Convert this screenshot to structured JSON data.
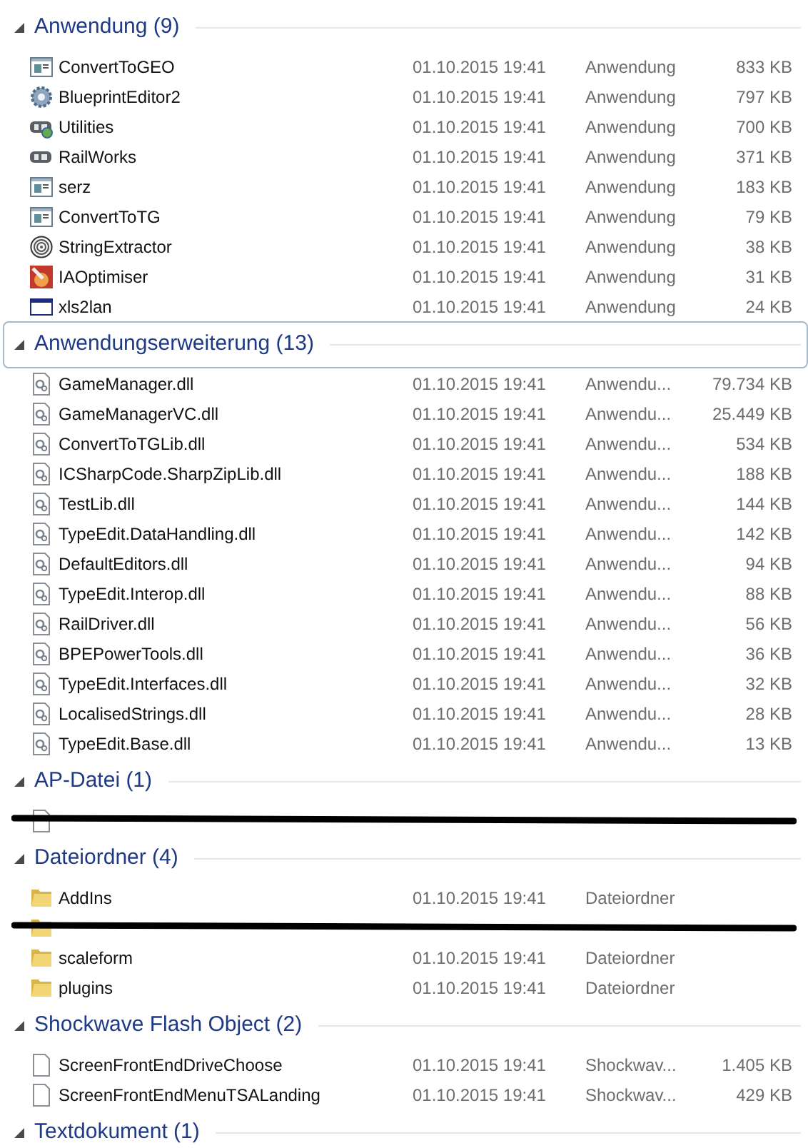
{
  "groups": [
    {
      "title": "Anwendung (9)",
      "expanded": true,
      "focused": false,
      "items": [
        {
          "kind": "app",
          "name": "ConvertToGEO",
          "date": "01.10.2015 19:41",
          "type": "Anwendung",
          "size": "833 KB"
        },
        {
          "kind": "gear",
          "name": "BlueprintEditor2",
          "date": "01.10.2015 19:41",
          "type": "Anwendung",
          "size": "797 KB"
        },
        {
          "kind": "badgeglobe",
          "name": "Utilities",
          "date": "01.10.2015 19:41",
          "type": "Anwendung",
          "size": "700 KB"
        },
        {
          "kind": "badge",
          "name": "RailWorks",
          "date": "01.10.2015 19:41",
          "type": "Anwendung",
          "size": "371 KB"
        },
        {
          "kind": "app",
          "name": "serz",
          "date": "01.10.2015 19:41",
          "type": "Anwendung",
          "size": "183 KB"
        },
        {
          "kind": "app",
          "name": "ConvertToTG",
          "date": "01.10.2015 19:41",
          "type": "Anwendung",
          "size": "79 KB"
        },
        {
          "kind": "fingerprint",
          "name": "StringExtractor",
          "date": "01.10.2015 19:41",
          "type": "Anwendung",
          "size": "38 KB"
        },
        {
          "kind": "tool",
          "name": "IAOptimiser",
          "date": "01.10.2015 19:41",
          "type": "Anwendung",
          "size": "31 KB"
        },
        {
          "kind": "window",
          "name": "xls2lan",
          "date": "01.10.2015 19:41",
          "type": "Anwendung",
          "size": "24 KB"
        }
      ]
    },
    {
      "title": "Anwendungserweiterung (13)",
      "expanded": true,
      "focused": true,
      "items": [
        {
          "kind": "dll",
          "name": "GameManager.dll",
          "date": "01.10.2015 19:41",
          "type": "Anwendu...",
          "size": "79.734 KB"
        },
        {
          "kind": "dll",
          "name": "GameManagerVC.dll",
          "date": "01.10.2015 19:41",
          "type": "Anwendu...",
          "size": "25.449 KB"
        },
        {
          "kind": "dll",
          "name": "ConvertToTGLib.dll",
          "date": "01.10.2015 19:41",
          "type": "Anwendu...",
          "size": "534 KB"
        },
        {
          "kind": "dll",
          "name": "ICSharpCode.SharpZipLib.dll",
          "date": "01.10.2015 19:41",
          "type": "Anwendu...",
          "size": "188 KB"
        },
        {
          "kind": "dll",
          "name": "TestLib.dll",
          "date": "01.10.2015 19:41",
          "type": "Anwendu...",
          "size": "144 KB"
        },
        {
          "kind": "dll",
          "name": "TypeEdit.DataHandling.dll",
          "date": "01.10.2015 19:41",
          "type": "Anwendu...",
          "size": "142 KB"
        },
        {
          "kind": "dll",
          "name": "DefaultEditors.dll",
          "date": "01.10.2015 19:41",
          "type": "Anwendu...",
          "size": "94 KB"
        },
        {
          "kind": "dll",
          "name": "TypeEdit.Interop.dll",
          "date": "01.10.2015 19:41",
          "type": "Anwendu...",
          "size": "88 KB"
        },
        {
          "kind": "dll",
          "name": "RailDriver.dll",
          "date": "01.10.2015 19:41",
          "type": "Anwendu...",
          "size": "56 KB"
        },
        {
          "kind": "dll",
          "name": "BPEPowerTools.dll",
          "date": "01.10.2015 19:41",
          "type": "Anwendu...",
          "size": "36 KB"
        },
        {
          "kind": "dll",
          "name": "TypeEdit.Interfaces.dll",
          "date": "01.10.2015 19:41",
          "type": "Anwendu...",
          "size": "32 KB"
        },
        {
          "kind": "dll",
          "name": "LocalisedStrings.dll",
          "date": "01.10.2015 19:41",
          "type": "Anwendu...",
          "size": "28 KB"
        },
        {
          "kind": "dll",
          "name": "TypeEdit.Base.dll",
          "date": "01.10.2015 19:41",
          "type": "Anwendu...",
          "size": "13 KB"
        }
      ]
    },
    {
      "title": "AP-Datei (1)",
      "expanded": true,
      "focused": false,
      "items": [
        {
          "kind": "redactedfile"
        }
      ]
    },
    {
      "title": "Dateiordner (4)",
      "expanded": true,
      "focused": false,
      "items": [
        {
          "kind": "folder",
          "name": "AddIns",
          "date": "01.10.2015 19:41",
          "type": "Dateiordner"
        },
        {
          "kind": "redactedfolder"
        },
        {
          "kind": "folder",
          "name": "scaleform",
          "date": "01.10.2015 19:41",
          "type": "Dateiordner"
        },
        {
          "kind": "folder",
          "name": "plugins",
          "date": "01.10.2015 19:41",
          "type": "Dateiordner"
        }
      ]
    },
    {
      "title": "Shockwave Flash Object (2)",
      "expanded": true,
      "focused": false,
      "items": [
        {
          "kind": "blank",
          "name": "ScreenFrontEndDriveChoose",
          "date": "01.10.2015 19:41",
          "type": "Shockwav...",
          "size": "1.405 KB"
        },
        {
          "kind": "blank",
          "name": "ScreenFrontEndMenuTSALanding",
          "date": "01.10.2015 19:41",
          "type": "Shockwav...",
          "size": "429 KB"
        }
      ]
    },
    {
      "title": "Textdokument (1)",
      "expanded": true,
      "focused": false
    }
  ]
}
